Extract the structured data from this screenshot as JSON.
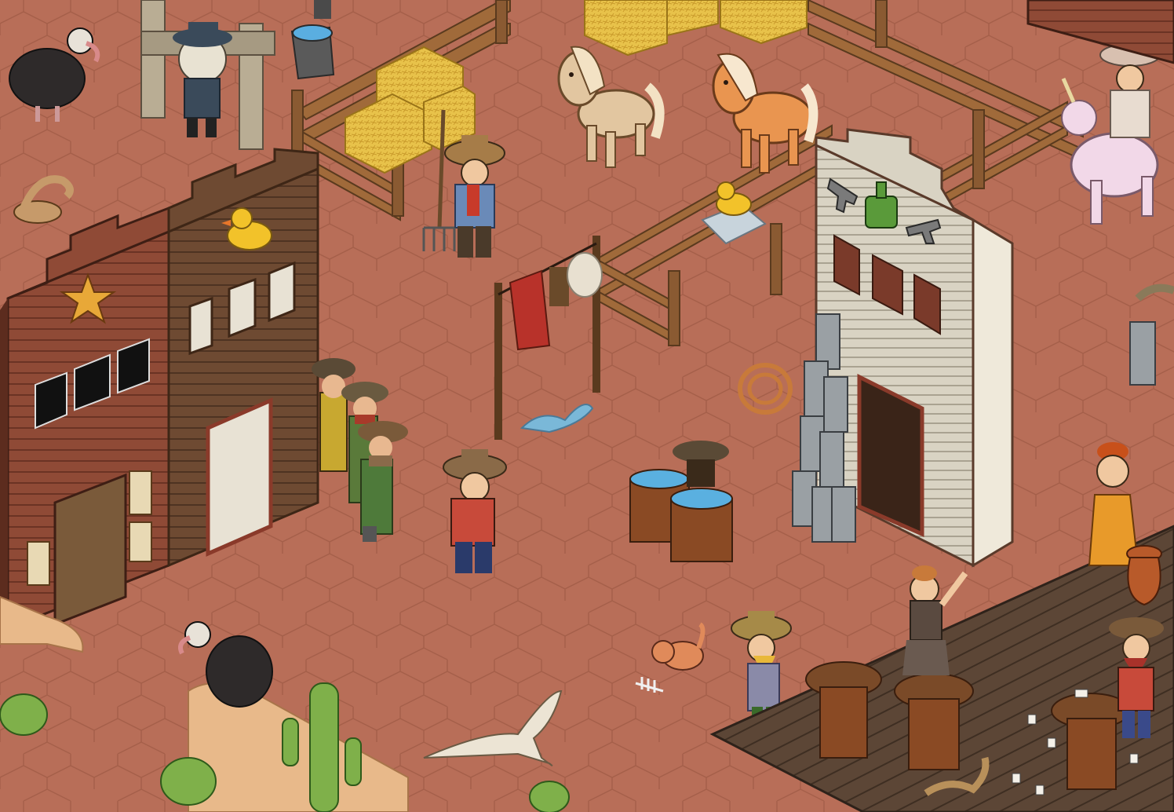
{
  "scene": {
    "setting": "Wild West town",
    "colors": {
      "ground": "#b86e58",
      "ground_line": "#a55f4a",
      "wood_dark": "#5a3422",
      "wood_mid": "#7a4a30",
      "wood_red": "#8f4a36",
      "plank_light": "#d8d2c4",
      "fence": "#8a5a32",
      "hay": "#e8c24a",
      "sand": "#e8b98a",
      "cactus": "#7fb04a",
      "deck": "#5c4636",
      "milk_can": "#9aa0a4",
      "horse_tan": "#e2c6a0",
      "horse_orange": "#e99550"
    }
  },
  "buildings": [
    {
      "id": "sheriff-office",
      "icon": "sheriff-star-icon"
    },
    {
      "id": "saloon-with-rubber-duck-sign",
      "icon": "rubber-duck-icon"
    },
    {
      "id": "bottle-and-revolvers-building",
      "icon": "whiskey-bottle-icon"
    }
  ],
  "characters": [
    {
      "id": "cowboy-with-pitchfork"
    },
    {
      "id": "cowboy-player"
    },
    {
      "id": "outlaw-bandit-1"
    },
    {
      "id": "outlaw-bandit-2"
    },
    {
      "id": "outlaw-bandit-3"
    },
    {
      "id": "skeleton-cowboy-in-stocks"
    },
    {
      "id": "rider-on-unicorn"
    },
    {
      "id": "dancing-lady-on-table"
    },
    {
      "id": "lady-in-orange-dress"
    },
    {
      "id": "bearded-cowboy"
    },
    {
      "id": "card-player"
    },
    {
      "id": "outlaw-behind-barrels"
    }
  ],
  "animals": [
    {
      "id": "vulture-top-left"
    },
    {
      "id": "vulture-on-rock"
    },
    {
      "id": "pony-tan"
    },
    {
      "id": "pony-orange"
    },
    {
      "id": "cat-orange"
    },
    {
      "id": "rattlesnake-left"
    },
    {
      "id": "rattlesnake-right"
    },
    {
      "id": "snake-on-deck"
    }
  ]
}
